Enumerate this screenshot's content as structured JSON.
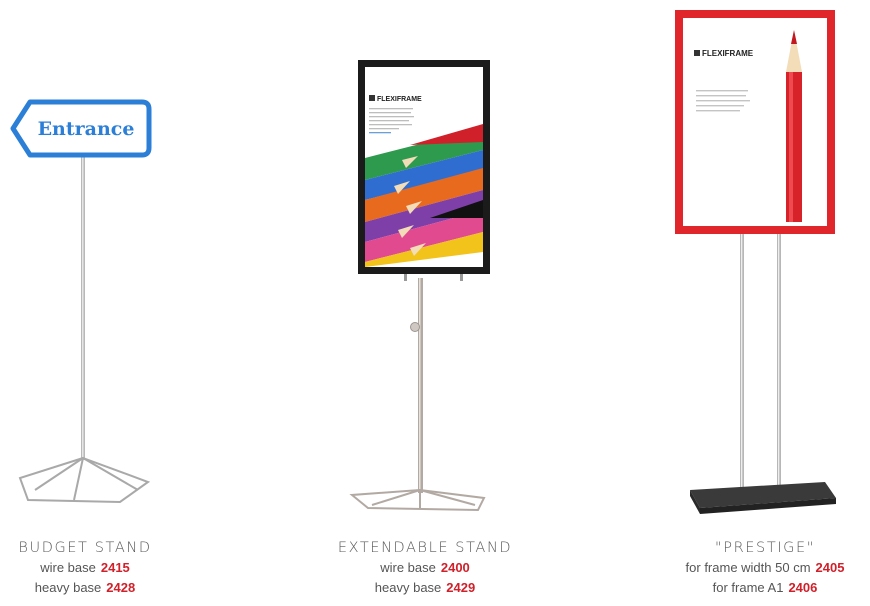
{
  "products": [
    {
      "title": "BUDGET STAND",
      "sign_text": "Entrance",
      "options": [
        {
          "label": "wire base",
          "code": "2415"
        },
        {
          "label": "heavy base",
          "code": "2428"
        }
      ]
    },
    {
      "title": "EXTENDABLE STAND",
      "brand": "FLEXIFRAME",
      "options": [
        {
          "label": "wire base",
          "code": "2400"
        },
        {
          "label": "heavy base",
          "code": "2429"
        }
      ]
    },
    {
      "title": "\"PRESTIGE\"",
      "brand": "FLEXIFRAME",
      "options": [
        {
          "label": "for frame width 50 cm",
          "code": "2405"
        },
        {
          "label": "for frame  A1",
          "code": "2406"
        }
      ]
    }
  ],
  "colors": {
    "code_red": "#d0202a",
    "sign_blue": "#2b7fd6",
    "frame_black": "#1b1b1b",
    "frame_red": "#e0262b"
  }
}
